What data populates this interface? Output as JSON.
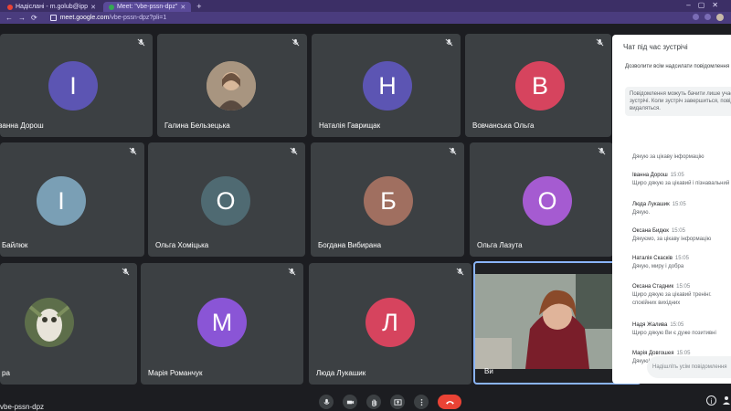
{
  "browser": {
    "tabs": [
      {
        "title": "Надіслані - m.golub@ipp",
        "favicon": "gmail-icon"
      },
      {
        "title": "Meet: \"vbe-pssn-dpz\"",
        "favicon": "meet-icon"
      }
    ],
    "new_tab": "+",
    "url_host": "meet.google.com",
    "url_path": "/vbe-pssn-dpz?pli=1"
  },
  "colors": {
    "tile_bg": "#3c4043",
    "self_border": "#8ab4f8",
    "leave_button": "#ea4335"
  },
  "participants": [
    {
      "name": "Іванна Дорош",
      "initial": "І",
      "color": "#5c55b3"
    },
    {
      "name": "Галина Бельзецька",
      "initial": "",
      "color": "#8a7a6a",
      "photo": true
    },
    {
      "name": "Наталія Гаврищак",
      "initial": "Н",
      "color": "#5c55b3"
    },
    {
      "name": "Вовчанська Ольга",
      "initial": "В",
      "color": "#d6445e"
    },
    {
      "name": "Байлюк",
      "initial": "І",
      "color": "#7a9fb5"
    },
    {
      "name": "Ольга Хоміцька",
      "initial": "О",
      "color": "#4f6a72"
    },
    {
      "name": "Богдана Вибирана",
      "initial": "Б",
      "color": "#a06f60"
    },
    {
      "name": "Ольга Лазута",
      "initial": "О",
      "color": "#a55bd1"
    },
    {
      "name": "ра",
      "initial": "",
      "color": "#6b7a5a",
      "photo": true
    },
    {
      "name": "Марія Романчук",
      "initial": "М",
      "color": "#8a55d6"
    },
    {
      "name": "Люда Лукашик",
      "initial": "Л",
      "color": "#d6445e"
    },
    {
      "name": "Ви",
      "initial": "",
      "color": "#202124",
      "self": true
    }
  ],
  "chat": {
    "title": "Чат під час зустрічі",
    "toggle_label": "Дозволити всім надсилати повідомлення",
    "note": "Повідомлення можуть бачити лише учасники зустрічі. Коли зустріч завершиться, повідомлення видаляться.",
    "messages": [
      {
        "sender": "",
        "time": "",
        "text": "Дякую за цікаву інформацію"
      },
      {
        "sender": "Іванна Дорош",
        "time": "15:05",
        "text": "Щиро дякую за цікавий і пізнавальний"
      },
      {
        "sender": "Люда Лукашик",
        "time": "15:05",
        "text": "Дякую."
      },
      {
        "sender": "Оксана Бидюк",
        "time": "15:05",
        "text": "Дякуємо, за цікаву інформацію"
      },
      {
        "sender": "Наталія Скасків",
        "time": "15:05",
        "text": "Дякую, миру і добра"
      },
      {
        "sender": "Оксана Стадник",
        "time": "15:05",
        "text": "Щиро дякую за цікавий тренінг."
      },
      {
        "sender": "",
        "time": "",
        "text": "спокійних вихідних"
      },
      {
        "sender": "Надя Жалива",
        "time": "15:05",
        "text": "Щиро дякую Ви є дуже позитивні"
      },
      {
        "sender": "Марія Довгошея",
        "time": "15:05",
        "text": "Дякую! Чекаю кожен день більше"
      }
    ],
    "input_placeholder": "Надішліть усім повідомлення"
  },
  "meeting_code": "vbe-pssn-dpz",
  "controls": [
    {
      "name": "mic-icon",
      "glyph": "🎙"
    },
    {
      "name": "camera-icon",
      "glyph": "■"
    },
    {
      "name": "raise-hand-icon",
      "glyph": "✋"
    },
    {
      "name": "present-icon",
      "glyph": "⬆"
    },
    {
      "name": "more-options-icon",
      "glyph": "⋮"
    },
    {
      "name": "leave-call-icon",
      "glyph": "☎"
    }
  ],
  "info_glyph": "i"
}
